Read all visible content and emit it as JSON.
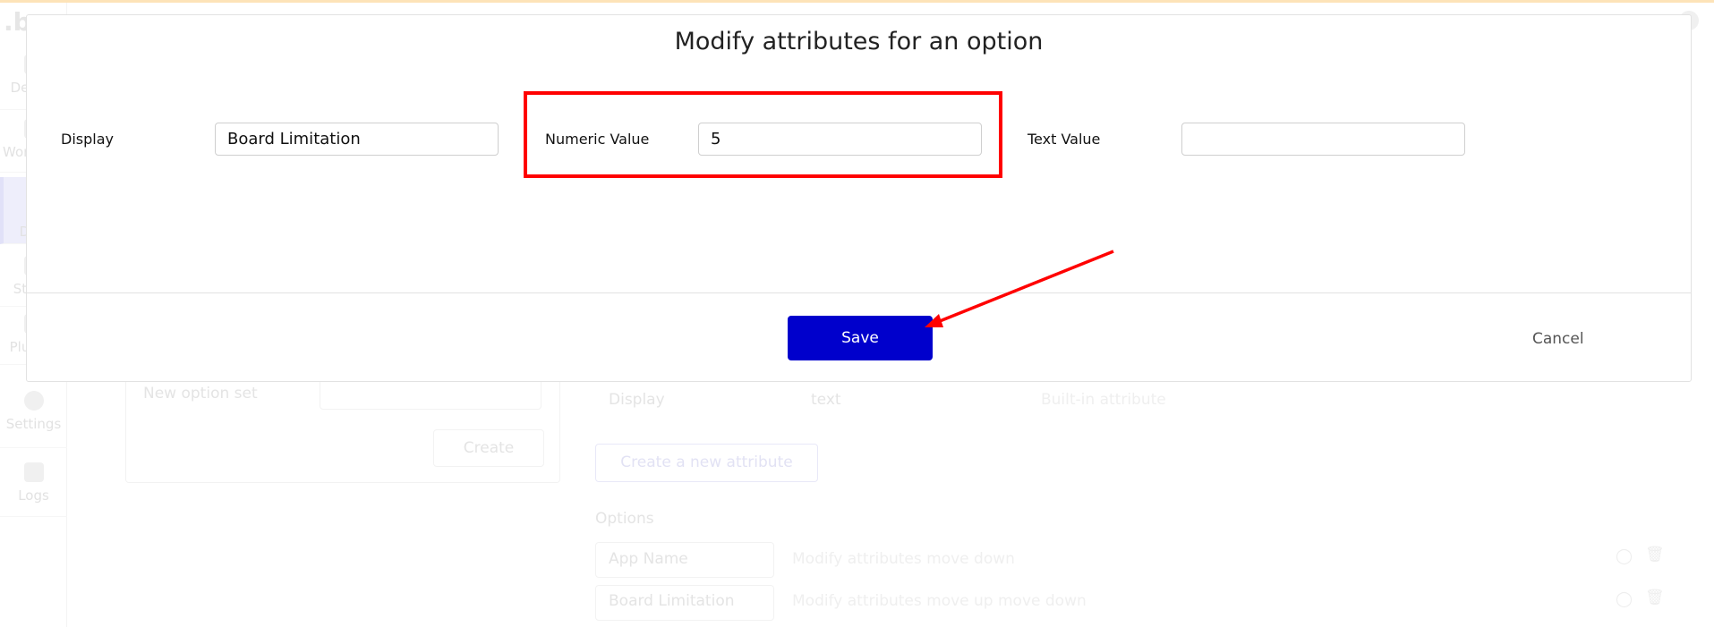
{
  "background": {
    "sidebar": [
      {
        "label": "Design",
        "icon": "design-icon"
      },
      {
        "label": "Workflow",
        "icon": "workflow-icon"
      },
      {
        "label": "Data",
        "icon": "data-icon",
        "selected": true
      },
      {
        "label": "Styles",
        "icon": "styles-icon"
      },
      {
        "label": "Plugins",
        "icon": "plugins-icon"
      },
      {
        "label": "Settings",
        "icon": "gear-icon"
      },
      {
        "label": "Logs",
        "icon": "document-icon"
      }
    ],
    "new_option_set_placeholder": "New option set",
    "create_label": "Create",
    "attribute_row": {
      "name": "Display",
      "type": "text",
      "note": "Built-in attribute"
    },
    "create_attribute_label": "Create a new attribute",
    "options_heading": "Options",
    "options": [
      {
        "name": "App Name",
        "actions": "Modify attributes  move down"
      },
      {
        "name": "Board Limitation",
        "actions": "Modify attributes  move up  move down"
      }
    ]
  },
  "modal": {
    "title": "Modify attributes for an option",
    "fields": [
      {
        "label": "Display",
        "value": "Board Limitation"
      },
      {
        "label": "Numeric Value",
        "value": "5"
      },
      {
        "label": "Text Value",
        "value": ""
      }
    ],
    "save_label": "Save",
    "cancel_label": "Cancel"
  },
  "annotation_colors": {
    "highlight": "#ff0000",
    "save_button": "#0000cc"
  }
}
